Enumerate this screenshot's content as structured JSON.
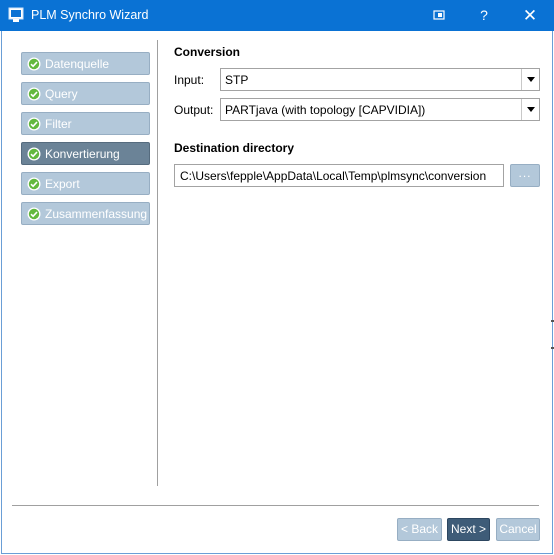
{
  "window": {
    "title": "PLM Synchro Wizard",
    "accent_color": "#0a72d4",
    "help_label": "?",
    "close_label": "✕",
    "extra_icon": "window-pin-icon"
  },
  "sidebar": {
    "items": [
      {
        "label": "Datenquelle",
        "status": "done",
        "active": false
      },
      {
        "label": "Query",
        "status": "done",
        "active": false
      },
      {
        "label": "Filter",
        "status": "done",
        "active": false
      },
      {
        "label": "Konvertierung",
        "status": "done",
        "active": true
      },
      {
        "label": "Export",
        "status": "done",
        "active": false
      },
      {
        "label": "Zusammenfassung",
        "status": "done",
        "active": false
      }
    ],
    "step_color": "#b3c8da",
    "active_color": "#6b8397",
    "check_color": "#62b83e"
  },
  "conversion": {
    "title": "Conversion",
    "input": {
      "label": "Input:",
      "value": "STP"
    },
    "output": {
      "label": "Output:",
      "value": "PARTjava (with topology [CAPVIDIA])"
    }
  },
  "destination": {
    "title": "Destination directory",
    "path": "C:\\Users\\fepple\\AppData\\Local\\Temp\\plmsync\\conversion",
    "browse_label": "..."
  },
  "footer": {
    "back_label": "< Back",
    "next_label": "Next >",
    "cancel_label": "Cancel"
  }
}
